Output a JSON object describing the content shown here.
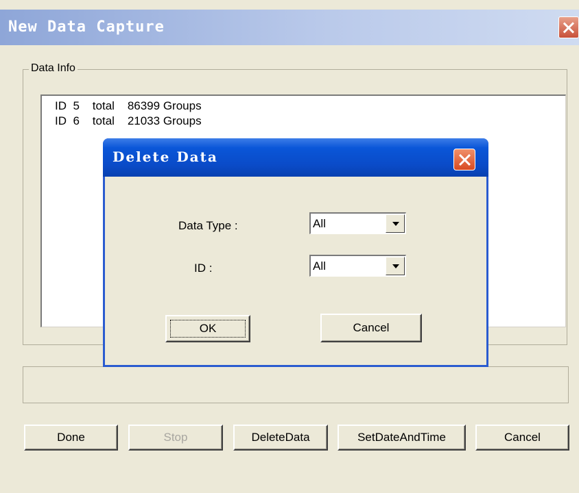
{
  "window": {
    "title": "New Data Capture"
  },
  "data_info": {
    "group_label": "Data Info",
    "rows": [
      "ID  5    total    86399 Groups",
      "ID  6    total    21033 Groups"
    ]
  },
  "buttons": {
    "done": "Done",
    "stop": "Stop",
    "delete_data": "DeleteData",
    "set_date_time": "SetDateAndTime",
    "cancel": "Cancel"
  },
  "delete_dialog": {
    "title": "Delete Data",
    "data_type_label": "Data Type :",
    "data_type_value": "All",
    "id_label": "ID :",
    "id_value": "All",
    "ok_label": "OK",
    "cancel_label": "Cancel"
  }
}
